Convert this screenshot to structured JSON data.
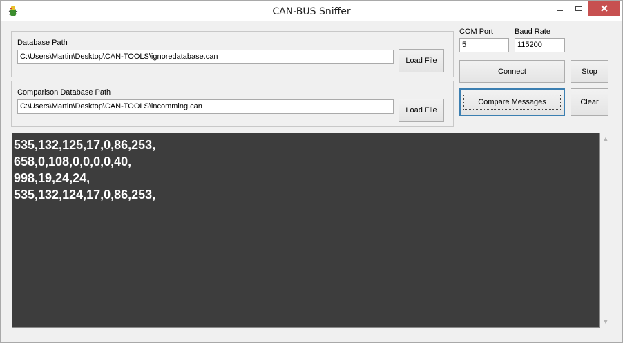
{
  "window": {
    "title": "CAN-BUS Sniffer",
    "icon": "bug-app-icon",
    "controls": {
      "minimize": "minimize-icon",
      "maximize": "maximize-icon",
      "close": "close-icon"
    }
  },
  "database": {
    "label": "Database Path",
    "path": "C:\\Users\\Martin\\Desktop\\CAN-TOOLS\\ignoredatabase.can",
    "load_label": "Load File"
  },
  "comparison": {
    "label": "Comparison Database Path",
    "path": "C:\\Users\\Martin\\Desktop\\CAN-TOOLS\\incomming.can",
    "load_label": "Load File"
  },
  "serial": {
    "com_label": "COM Port",
    "com_value": "5",
    "baud_label": "Baud Rate",
    "baud_value": "115200"
  },
  "buttons": {
    "connect": "Connect",
    "stop": "Stop",
    "compare": "Compare Messages",
    "clear": "Clear"
  },
  "log": {
    "lines": [
      "535,132,125,17,0,86,253,",
      "658,0,108,0,0,0,0,40,",
      "998,19,24,24,",
      "535,132,124,17,0,86,253,"
    ]
  },
  "colors": {
    "log_background": "#3d3d3d",
    "log_text": "#ffffff",
    "close_button": "#c75050",
    "focus_border": "#3c7fb1"
  }
}
